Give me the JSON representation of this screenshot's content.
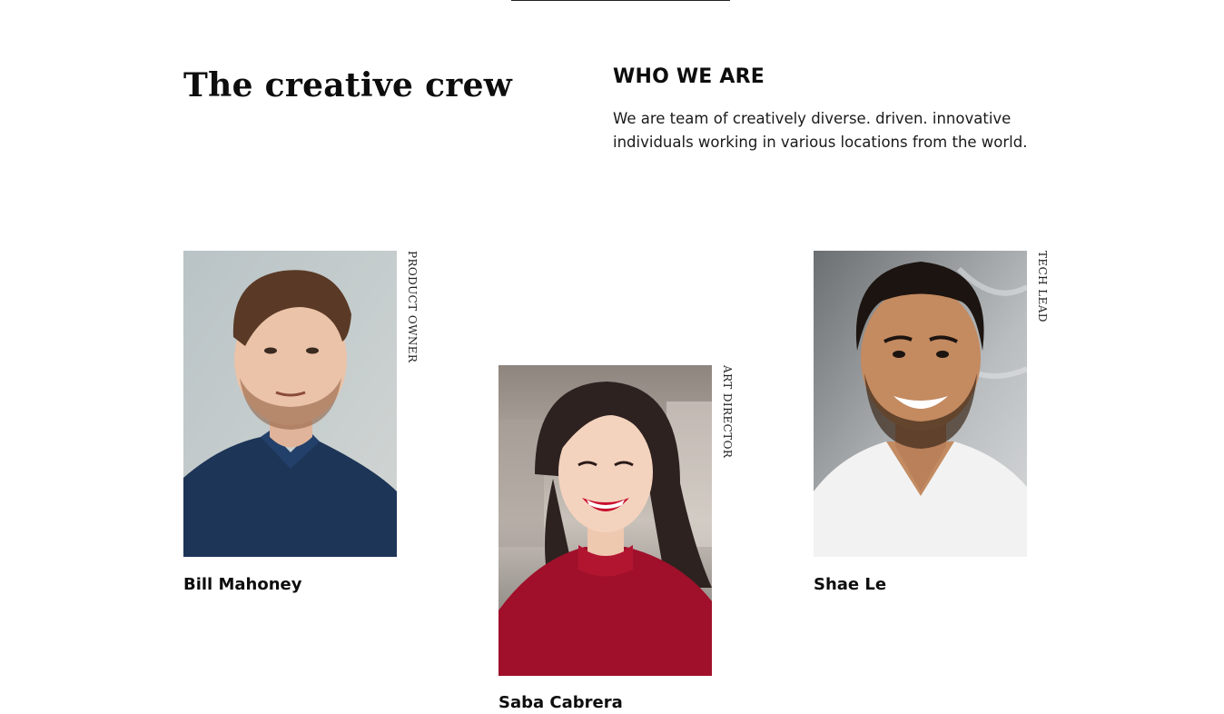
{
  "header": {
    "title": "The creative crew"
  },
  "about": {
    "heading": "WHO WE ARE",
    "text": "We are team of creatively diverse. driven. innovative individuals working in various locations from the world."
  },
  "team": [
    {
      "name": "Bill Mahoney",
      "role": "PRODUCT OWNER",
      "photo": "portrait-man-navy-polo"
    },
    {
      "name": "Saba Cabrera",
      "role": "ART DIRECTOR",
      "photo": "portrait-woman-red-sweater"
    },
    {
      "name": "Shae Le",
      "role": "TECH LEAD",
      "photo": "portrait-man-white-tshirt"
    }
  ],
  "colors": {
    "text": "#0d0d0d",
    "background": "#ffffff"
  }
}
